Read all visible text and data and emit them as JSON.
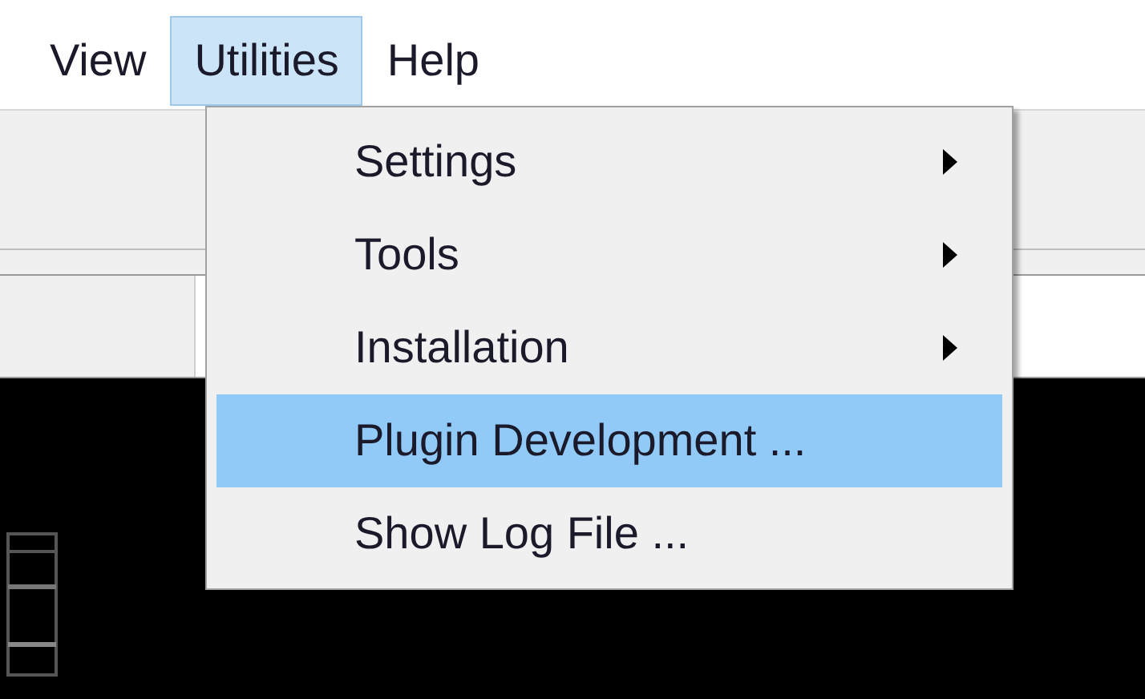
{
  "menu_bar": [
    {
      "label": "View",
      "selected": false
    },
    {
      "label": "Utilities",
      "selected": true
    },
    {
      "label": "Help",
      "selected": false
    }
  ],
  "menu": {
    "items": [
      {
        "label": "Settings",
        "has_submenu": true,
        "selected": false
      },
      {
        "label": "Tools",
        "has_submenu": true,
        "selected": false
      },
      {
        "label": "Installation",
        "has_submenu": true,
        "selected": false
      },
      {
        "label": "Plugin Development ...",
        "has_submenu": false,
        "selected": true
      },
      {
        "label": "Show Log File ...",
        "has_submenu": false,
        "selected": false
      }
    ]
  }
}
